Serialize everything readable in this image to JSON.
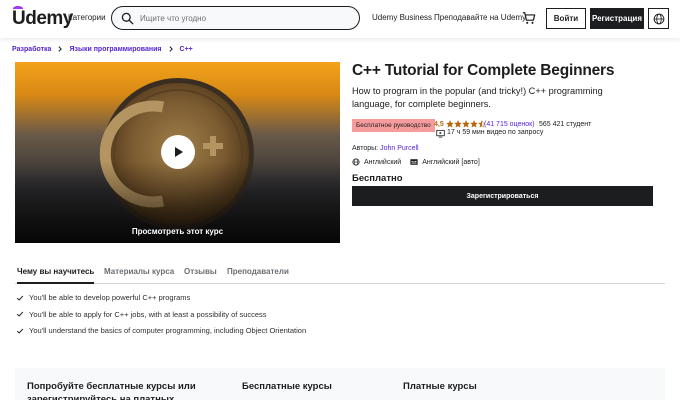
{
  "header": {
    "logo": "Udemy",
    "categories": "Категории",
    "search_placeholder": "Ищите что угодно",
    "business": "Udemy Business",
    "teach": "Преподавайте на Udemy",
    "login": "Войти",
    "signup": "Регистрация"
  },
  "breadcrumb": [
    "Разработка",
    "Языки программирования",
    "C++"
  ],
  "video": {
    "preview_label": "Просмотреть этот курс"
  },
  "course": {
    "title": "C++ Tutorial for Complete Beginners",
    "subtitle": "How to program in the popular (and tricky!) C++ programming language, for complete beginners.",
    "badge": "Бесплатное руководство",
    "rating": "4,5",
    "rating_stars": 4.5,
    "rating_count": "(41 715 оценок)",
    "students": "565 421 студент",
    "duration": "17 ч 59 мин видео по запросу",
    "authors_label": "Авторы:",
    "author": "John Purcell",
    "audio_language": "Английский",
    "caption_language": "Английский [авто]",
    "price": "Бесплатно",
    "enroll": "Зарегистрироваться"
  },
  "tabs": [
    "Чему вы научитесь",
    "Материалы курса",
    "Отзывы",
    "Преподаватели"
  ],
  "objectives": [
    "You'll be able to develop powerful C++ programs",
    "You'll be able to apply for C++ jobs, with at least a possibility of success",
    "You'll understand the basics of computer programming, including Object Orientation"
  ],
  "promo": {
    "col1": "Попробуйте бесплатные курсы или зарегистрируйтесь на платных курсах",
    "col2": "Бесплатные курсы",
    "col3": "Платные курсы"
  },
  "colors": {
    "brand": "#a435f0",
    "link": "#5624d0",
    "rating": "#b4690e",
    "badge": "#f69c9c",
    "dark": "#1c1d1f"
  }
}
